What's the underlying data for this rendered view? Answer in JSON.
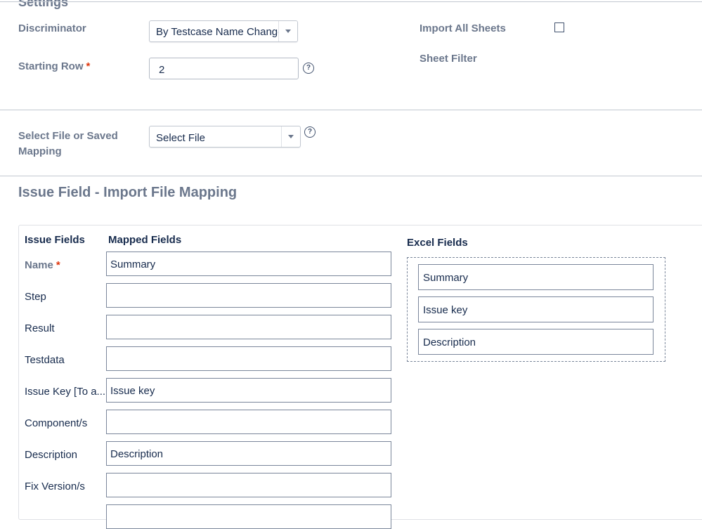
{
  "settings": {
    "title": "Settings",
    "discriminator_label": "Discriminator",
    "discriminator_value": "By Testcase Name Change",
    "starting_row_label": "Starting Row",
    "required_mark": "*",
    "starting_row_value": "2",
    "help_glyph": "?",
    "import_all_sheets_label": "Import All Sheets",
    "import_all_sheets_checked": false,
    "sheet_filter_label": "Sheet Filter"
  },
  "file_select": {
    "label_line1": "Select File or Saved",
    "label_line2": "Mapping",
    "value": "Select File"
  },
  "mapping": {
    "title": "Issue Field - Import File Mapping",
    "issue_fields_header": "Issue Fields",
    "mapped_fields_header": "Mapped Fields",
    "excel_fields_header": "Excel Fields",
    "rows": [
      {
        "field": "Name",
        "required": true,
        "mapped": "Summary"
      },
      {
        "field": "Step",
        "required": false,
        "mapped": ""
      },
      {
        "field": "Result",
        "required": false,
        "mapped": ""
      },
      {
        "field": "Testdata",
        "required": false,
        "mapped": ""
      },
      {
        "field": "Issue Key [To a...",
        "required": false,
        "mapped": "Issue key"
      },
      {
        "field": "Component/s",
        "required": false,
        "mapped": ""
      },
      {
        "field": "Description",
        "required": false,
        "mapped": "Description"
      },
      {
        "field": "Fix Version/s",
        "required": false,
        "mapped": ""
      }
    ],
    "excel_fields": [
      "Summary",
      "Issue key",
      "Description"
    ]
  }
}
